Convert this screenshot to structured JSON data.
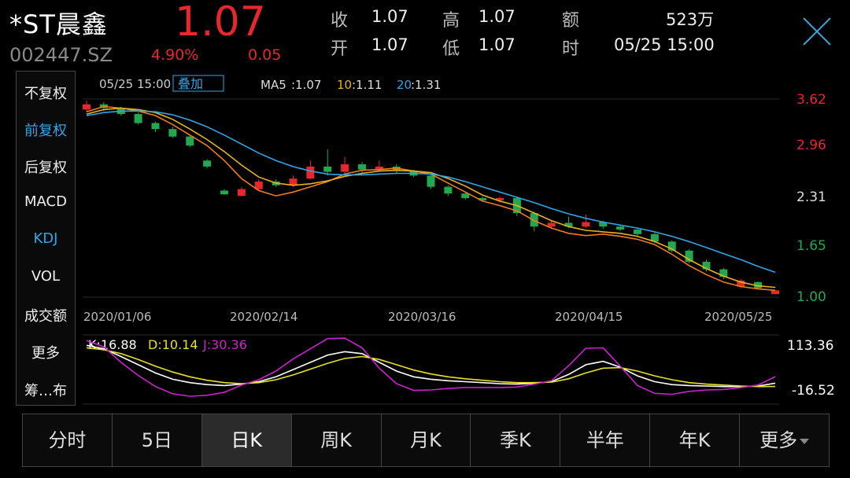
{
  "stock": {
    "name": "*ST晨鑫",
    "code": "002447.SZ",
    "price": "1.07",
    "change_pct": "4.90%",
    "change_abs": "0.05"
  },
  "quote": {
    "close_label": "收",
    "close_value": "1.07",
    "open_label": "开",
    "open_value": "1.07",
    "high_label": "高",
    "high_value": "1.07",
    "low_label": "低",
    "low_value": "1.07",
    "amount_label": "额",
    "amount_value": "523万",
    "time_label": "时",
    "time_value": "05/25 15:00"
  },
  "sidebar": {
    "items": [
      {
        "label": "不复权",
        "active": false
      },
      {
        "label": "前复权",
        "active": true
      },
      {
        "label": "后复权",
        "active": false
      },
      {
        "label": "MACD",
        "active": false
      },
      {
        "label": "KDJ",
        "active": true
      },
      {
        "label": "VOL",
        "active": false
      },
      {
        "label": "成交额",
        "active": false
      },
      {
        "label": "更多",
        "active": false
      },
      {
        "label": "筹…布",
        "active": false
      }
    ]
  },
  "chart_info": {
    "datetime": "05/25 15:00",
    "overlay_label": "叠加",
    "ma5_label": "MA5",
    "ma5_value": ":1.07",
    "ma10_label": "10",
    "ma10_value": ":1.11",
    "ma20_label": "20",
    "ma20_value": ":1.31",
    "kdj_k": "K:16.88",
    "kdj_d": "D:10.14",
    "kdj_j": "J:30.36"
  },
  "colors": {
    "up": "#e8262d",
    "down": "#22a94f",
    "ma5": "#f07a1e",
    "ma10": "#e8b21e",
    "ma20": "#2ea6ea",
    "k": "#ffffff",
    "d": "#e8e020",
    "j": "#d21ed2"
  },
  "chart_data": [
    {
      "type": "candlestick",
      "title": "",
      "x_ticks": [
        "2020/01/06",
        "2020/02/14",
        "2020/03/16",
        "2020/04/15",
        "2020/05/25"
      ],
      "price_ticks": [
        "3.62",
        "2.96",
        "2.31",
        "1.65",
        "1.00"
      ],
      "ylim": [
        1.0,
        3.62
      ],
      "series": [
        {
          "name": "MA5",
          "values": [
            3.45,
            3.52,
            3.5,
            3.46,
            3.4,
            3.28,
            3.14,
            3.0,
            2.8,
            2.56,
            2.4,
            2.33,
            2.38,
            2.45,
            2.52,
            2.62,
            2.67,
            2.68,
            2.7,
            2.66,
            2.62,
            2.5,
            2.38,
            2.26,
            2.2,
            2.13,
            2.0,
            1.9,
            1.83,
            1.8,
            1.82,
            1.79,
            1.75,
            1.68,
            1.55,
            1.4,
            1.28,
            1.18,
            1.12,
            1.09,
            1.07
          ]
        },
        {
          "name": "10",
          "values": [
            3.42,
            3.48,
            3.5,
            3.48,
            3.44,
            3.35,
            3.22,
            3.08,
            2.92,
            2.74,
            2.58,
            2.5,
            2.47,
            2.49,
            2.53,
            2.59,
            2.63,
            2.66,
            2.67,
            2.66,
            2.64,
            2.56,
            2.46,
            2.34,
            2.26,
            2.2,
            2.1,
            2.0,
            1.92,
            1.87,
            1.85,
            1.83,
            1.79,
            1.72,
            1.62,
            1.48,
            1.36,
            1.26,
            1.18,
            1.13,
            1.11
          ]
        },
        {
          "name": "20",
          "values": [
            3.4,
            3.44,
            3.46,
            3.46,
            3.45,
            3.41,
            3.34,
            3.25,
            3.14,
            3.02,
            2.9,
            2.8,
            2.72,
            2.66,
            2.62,
            2.61,
            2.61,
            2.62,
            2.63,
            2.63,
            2.62,
            2.58,
            2.52,
            2.45,
            2.38,
            2.31,
            2.24,
            2.16,
            2.09,
            2.03,
            1.98,
            1.94,
            1.9,
            1.85,
            1.79,
            1.72,
            1.64,
            1.56,
            1.48,
            1.39,
            1.31
          ]
        }
      ],
      "candles": [
        {
          "o": 3.48,
          "c": 3.55,
          "h": 3.6,
          "l": 3.45
        },
        {
          "o": 3.55,
          "c": 3.5,
          "h": 3.58,
          "l": 3.46
        },
        {
          "o": 3.5,
          "c": 3.42,
          "h": 3.52,
          "l": 3.4
        },
        {
          "o": 3.42,
          "c": 3.3,
          "h": 3.44,
          "l": 3.28
        },
        {
          "o": 3.3,
          "c": 3.22,
          "h": 3.32,
          "l": 3.18
        },
        {
          "o": 3.22,
          "c": 3.12,
          "h": 3.25,
          "l": 3.1
        },
        {
          "o": 3.12,
          "c": 3.0,
          "h": 3.14,
          "l": 2.98
        },
        {
          "o": 2.8,
          "c": 2.72,
          "h": 2.82,
          "l": 2.7
        },
        {
          "o": 2.4,
          "c": 2.35,
          "h": 2.42,
          "l": 2.34
        },
        {
          "o": 2.33,
          "c": 2.42,
          "h": 2.45,
          "l": 2.32
        },
        {
          "o": 2.42,
          "c": 2.52,
          "h": 2.55,
          "l": 2.4
        },
        {
          "o": 2.52,
          "c": 2.47,
          "h": 2.55,
          "l": 2.45
        },
        {
          "o": 2.47,
          "c": 2.56,
          "h": 2.6,
          "l": 2.45
        },
        {
          "o": 2.56,
          "c": 2.72,
          "h": 2.8,
          "l": 2.55
        },
        {
          "o": 2.72,
          "c": 2.65,
          "h": 2.95,
          "l": 2.6
        },
        {
          "o": 2.65,
          "c": 2.75,
          "h": 2.85,
          "l": 2.63
        },
        {
          "o": 2.75,
          "c": 2.68,
          "h": 2.78,
          "l": 2.62
        },
        {
          "o": 2.68,
          "c": 2.72,
          "h": 2.8,
          "l": 2.66
        },
        {
          "o": 2.72,
          "c": 2.66,
          "h": 2.75,
          "l": 2.62
        },
        {
          "o": 2.66,
          "c": 2.6,
          "h": 2.68,
          "l": 2.58
        },
        {
          "o": 2.6,
          "c": 2.45,
          "h": 2.62,
          "l": 2.42
        },
        {
          "o": 2.45,
          "c": 2.36,
          "h": 2.47,
          "l": 2.33
        },
        {
          "o": 2.36,
          "c": 2.3,
          "h": 2.38,
          "l": 2.28
        },
        {
          "o": 2.3,
          "c": 2.27,
          "h": 2.32,
          "l": 2.25
        },
        {
          "o": 2.27,
          "c": 2.3,
          "h": 2.32,
          "l": 2.24
        },
        {
          "o": 2.3,
          "c": 2.1,
          "h": 2.32,
          "l": 2.06
        },
        {
          "o": 2.1,
          "c": 1.92,
          "h": 2.12,
          "l": 1.86
        },
        {
          "o": 1.92,
          "c": 1.97,
          "h": 2.0,
          "l": 1.9
        },
        {
          "o": 1.97,
          "c": 1.92,
          "h": 2.05,
          "l": 1.9
        },
        {
          "o": 1.92,
          "c": 1.98,
          "h": 2.08,
          "l": 1.9
        },
        {
          "o": 1.98,
          "c": 1.92,
          "h": 2.0,
          "l": 1.89
        },
        {
          "o": 1.92,
          "c": 1.88,
          "h": 1.94,
          "l": 1.86
        },
        {
          "o": 1.88,
          "c": 1.82,
          "h": 1.9,
          "l": 1.8
        },
        {
          "o": 1.82,
          "c": 1.72,
          "h": 1.84,
          "l": 1.7
        },
        {
          "o": 1.72,
          "c": 1.6,
          "h": 1.74,
          "l": 1.58
        },
        {
          "o": 1.6,
          "c": 1.45,
          "h": 1.62,
          "l": 1.43
        },
        {
          "o": 1.45,
          "c": 1.35,
          "h": 1.48,
          "l": 1.32
        },
        {
          "o": 1.35,
          "c": 1.25,
          "h": 1.37,
          "l": 1.22
        },
        {
          "o": 1.12,
          "c": 1.2,
          "h": 1.22,
          "l": 1.1
        },
        {
          "o": 1.18,
          "c": 1.1,
          "h": 1.19,
          "l": 1.08
        },
        {
          "o": 1.02,
          "c": 1.07,
          "h": 1.07,
          "l": 1.02
        }
      ]
    },
    {
      "type": "line",
      "title": "",
      "y_ticks": [
        "113.36",
        "-16.52"
      ],
      "ylim": [
        -16.52,
        113.36
      ],
      "series": [
        {
          "name": "K",
          "values": [
            95,
            88,
            72,
            55,
            38,
            25,
            18,
            14,
            12,
            15,
            20,
            30,
            45,
            60,
            75,
            82,
            78,
            60,
            42,
            30,
            25,
            22,
            20,
            18,
            16,
            15,
            17,
            20,
            35,
            55,
            62,
            50,
            32,
            20,
            14,
            12,
            11,
            10,
            10,
            11,
            16.88
          ]
        },
        {
          "name": "D",
          "values": [
            90,
            86,
            78,
            66,
            52,
            40,
            30,
            23,
            18,
            16,
            18,
            24,
            34,
            46,
            58,
            68,
            72,
            66,
            55,
            44,
            36,
            30,
            26,
            23,
            20,
            18,
            18,
            19,
            26,
            38,
            48,
            49,
            42,
            32,
            24,
            18,
            15,
            13,
            11,
            10,
            10.14
          ]
        },
        {
          "name": "J",
          "values": [
            105,
            92,
            60,
            33,
            10,
            -5,
            -10,
            -8,
            -2,
            13,
            24,
            42,
            67,
            88,
            109,
            110,
            90,
            48,
            16,
            2,
            3,
            6,
            8,
            8,
            8,
            9,
            15,
            22,
            53,
            89,
            90,
            52,
            12,
            -4,
            -6,
            0,
            3,
            4,
            8,
            13,
            30.36
          ]
        }
      ]
    }
  ],
  "tabs": [
    {
      "label": "分时",
      "active": false
    },
    {
      "label": "5日",
      "active": false
    },
    {
      "label": "日K",
      "active": true
    },
    {
      "label": "周K",
      "active": false
    },
    {
      "label": "月K",
      "active": false
    },
    {
      "label": "季K",
      "active": false
    },
    {
      "label": "半年",
      "active": false
    },
    {
      "label": "年K",
      "active": false
    },
    {
      "label": "更多",
      "active": false,
      "dropdown": true
    }
  ]
}
